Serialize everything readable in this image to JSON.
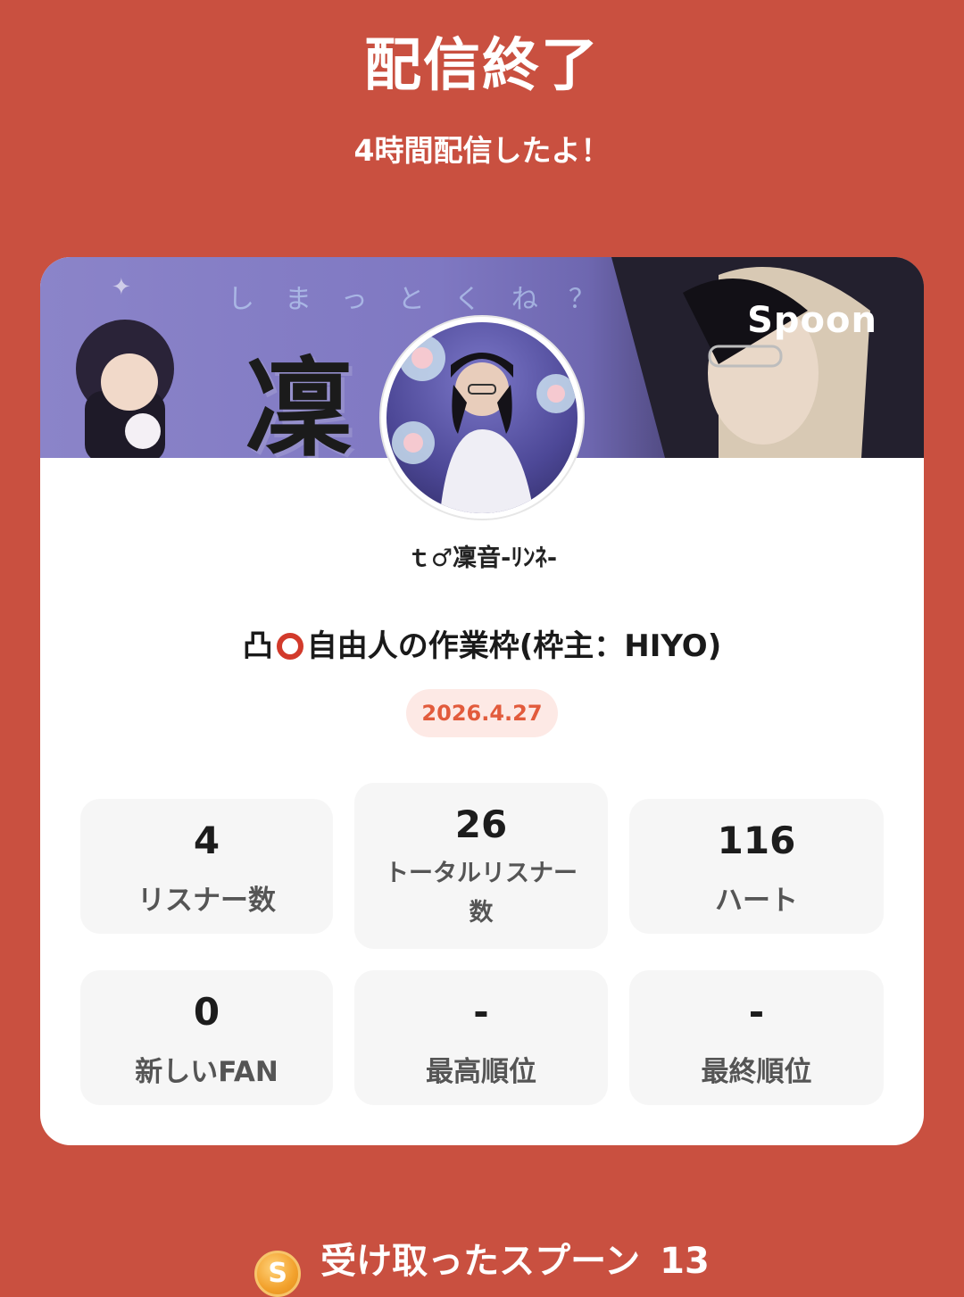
{
  "header": {
    "title": "配信終了",
    "subtitle": "4時間配信したよ！"
  },
  "banner": {
    "overlay_text": "しまっとくね？",
    "kanji": "凜",
    "logo": "Spoon"
  },
  "profile": {
    "username": "ｔ♂凜音-ﾘﾝﾈ-"
  },
  "live": {
    "title_prefix": "凸",
    "title_main": "自由人の作業枠(枠主：HIYO)",
    "date": "2026.4.27"
  },
  "stats": [
    {
      "value": "4",
      "label": "リスナー数"
    },
    {
      "value": "26",
      "label": "トータルリスナー数"
    },
    {
      "value": "116",
      "label": "ハート"
    },
    {
      "value": "0",
      "label": "新しいFAN"
    },
    {
      "value": "-",
      "label": "最高順位"
    },
    {
      "value": "-",
      "label": "最終順位"
    }
  ],
  "footer": {
    "coin_symbol": "S",
    "label": "受け取ったスプーン",
    "count": "13"
  },
  "colors": {
    "background": "#c95040",
    "card": "#ffffff",
    "stat_bg": "#f6f6f6",
    "date_text": "#e25b3c",
    "date_bg": "#fde9e5"
  },
  "icons": [
    "record-circle-icon",
    "spoon-coin-icon"
  ]
}
